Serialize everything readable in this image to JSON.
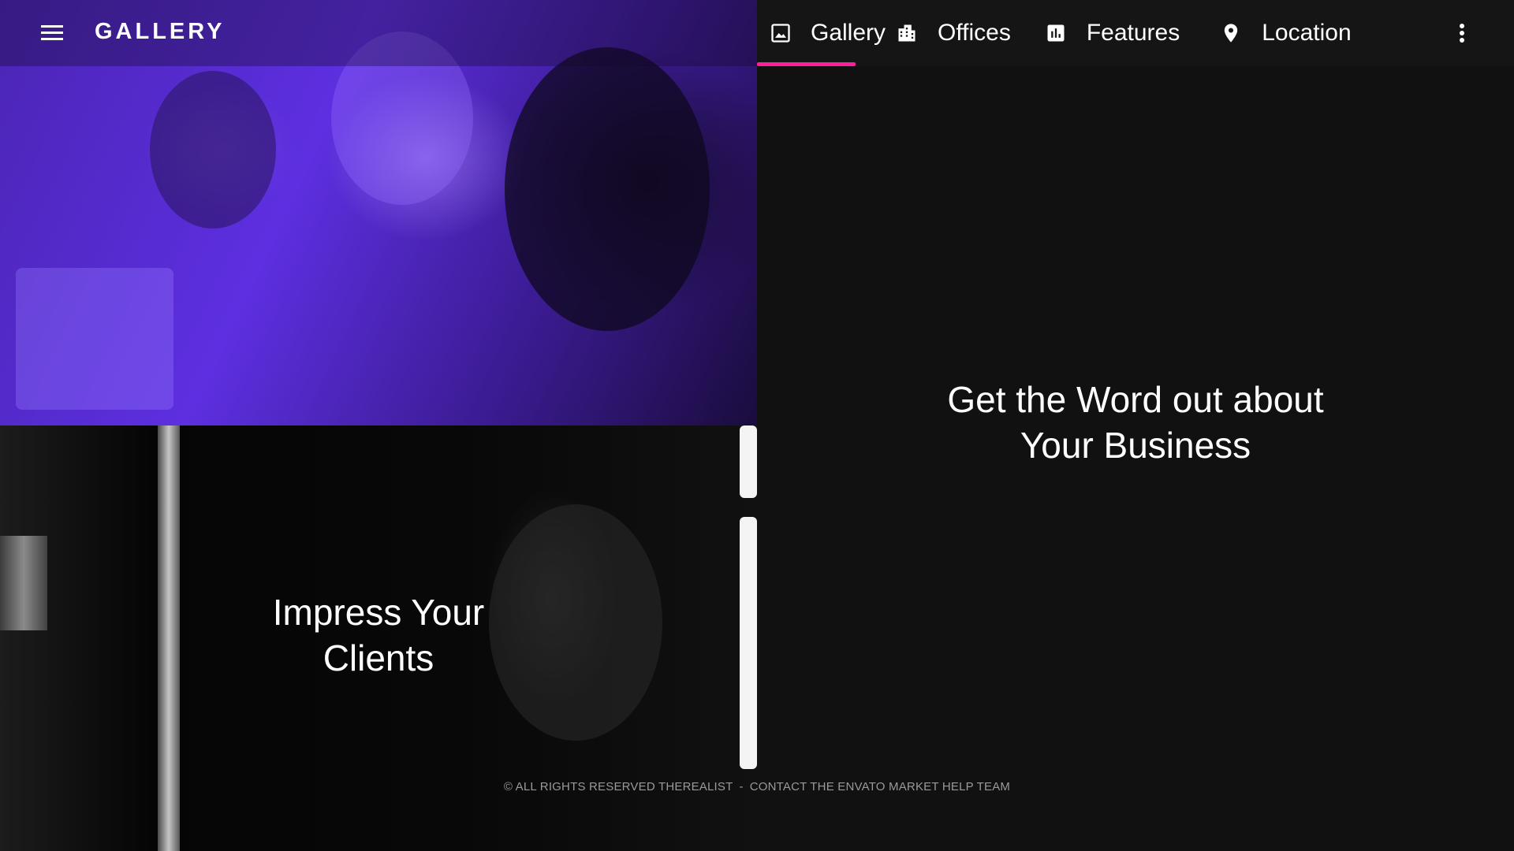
{
  "header": {
    "brand": "GALLERY",
    "menu_icon": "hamburger-menu-icon",
    "more_icon": "more-vertical-icon"
  },
  "tabs": [
    {
      "label": "Gallery",
      "icon": "image-icon",
      "active": true
    },
    {
      "label": "Offices",
      "icon": "building-icon",
      "active": false
    },
    {
      "label": "Features",
      "icon": "bar-chart-icon",
      "active": false
    },
    {
      "label": "Location",
      "icon": "location-pin-icon",
      "active": false
    }
  ],
  "tiles": {
    "bottom_left_caption_line1": "Impress Your",
    "bottom_left_caption_line2": "Clients",
    "right_caption_line1": "Get the Word out about",
    "right_caption_line2": "Your Business"
  },
  "footer": {
    "copyright": "© ALL RIGHTS RESERVED THEREALIST",
    "separator": "-",
    "help_link": "CONTACT THE ENVATO MARKET HELP TEAM"
  },
  "colors": {
    "accent": "#ff1f9a",
    "panel_bg": "#111111",
    "photo_tint": "#5d2fe0"
  }
}
